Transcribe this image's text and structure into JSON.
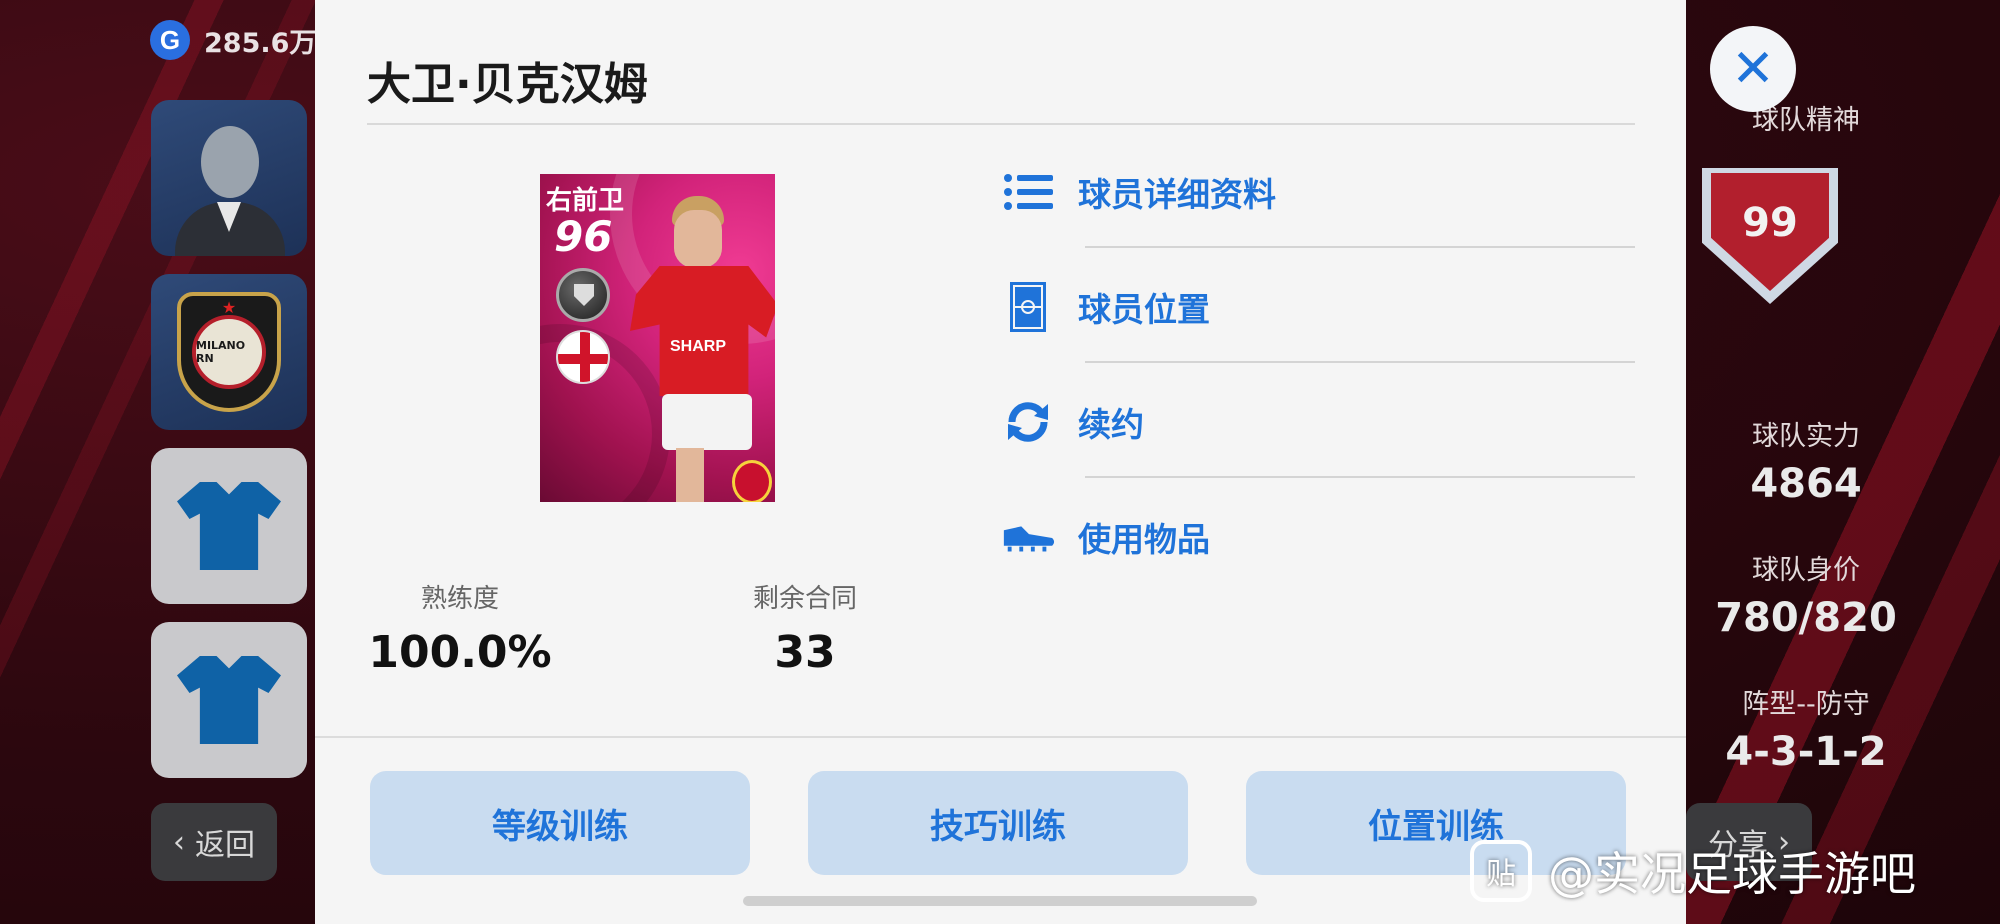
{
  "background": {
    "currency": {
      "icon": "G",
      "amount": "285.6万"
    },
    "back_button": "返回",
    "share_button": "分享",
    "team_spirit": {
      "label": "球队精神",
      "value": "99"
    },
    "team_strength": {
      "label": "球队实力",
      "value": "4864"
    },
    "team_value": {
      "label": "球队身价",
      "value": "780/820"
    },
    "formation": {
      "label": "阵型--防守",
      "value": "4-3-1-2"
    },
    "club_badge_text": "MILANO RN"
  },
  "modal": {
    "title": "大卫·贝克汉姆",
    "card": {
      "position": "右前卫",
      "rating": "96",
      "sponsor": "SHARP"
    },
    "stats": [
      {
        "label": "熟练度",
        "value": "100.0%"
      },
      {
        "label": "剩余合同",
        "value": "33"
      }
    ],
    "menu": [
      {
        "label": "球员详细资料",
        "icon": "list-icon"
      },
      {
        "label": "球员位置",
        "icon": "pitch-icon"
      },
      {
        "label": "续约",
        "icon": "refresh-icon"
      },
      {
        "label": "使用物品",
        "icon": "boot-icon"
      }
    ],
    "buttons": [
      "等级训练",
      "技巧训练",
      "位置训练"
    ]
  },
  "watermark": {
    "logo": "贴",
    "text": "@实况足球手游吧"
  },
  "colors": {
    "accent": "#1f73d9",
    "button_bg": "#c9dcf0",
    "card_pink": "#d2237a"
  }
}
